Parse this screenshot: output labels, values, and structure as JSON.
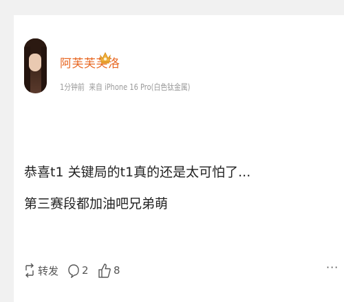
{
  "post": {
    "username": "阿芙芙芙洛",
    "meta": {
      "time": "1分钟前",
      "source": "来自 iPhone 16 Pro(白色钛金属)"
    },
    "content": {
      "line1": "恭喜t1 关键局的t1真的还是太可怕了...",
      "line2": "第三赛段都加油吧兄弟萌"
    },
    "actions": {
      "repost_label": "转发",
      "comment_count": "2",
      "like_count": "8"
    }
  },
  "icons": {
    "vip": "crown-badge-icon",
    "repost": "repost-icon",
    "comment": "comment-icon",
    "like": "thumbs-up-icon",
    "more": "more-icon"
  },
  "colors": {
    "username": "#e86722",
    "badge": "#f0b13c",
    "text": "#222222",
    "meta": "#9a9a9a",
    "background": "#f1f1f1"
  }
}
